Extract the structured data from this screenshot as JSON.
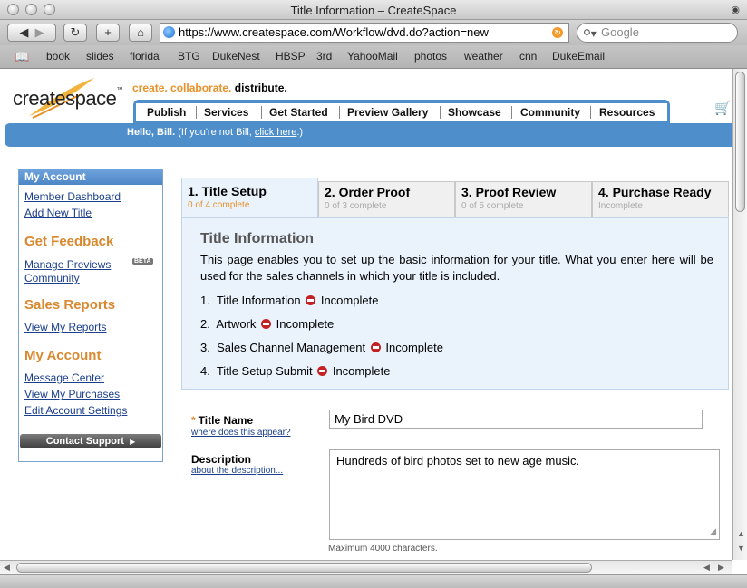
{
  "window": {
    "title": "Title Information – CreateSpace"
  },
  "toolbar": {
    "url": "https://www.createspace.com/Workflow/dvd.do?action=new",
    "search_placeholder": "Google"
  },
  "bookmarks": [
    "book",
    "slides",
    "florida",
    "BTG",
    "DukeNest",
    "HBSP",
    "3rd",
    "YahooMail",
    "photos",
    "weather",
    "cnn",
    "DukeEmail"
  ],
  "header": {
    "logo": "createspace",
    "tagline_part1": "create. collaborate.",
    "tagline_part2": "distribute.",
    "nav": [
      "Publish",
      "Services",
      "Get Started",
      "Preview Gallery",
      "Showcase",
      "Community",
      "Resources"
    ],
    "hello_name": "Hello, Bill.",
    "hello_note": "(If you're not Bill,",
    "hello_link": "click here",
    "hello_end": ".)"
  },
  "sidebar": {
    "top_header": "My Account",
    "links1": [
      "Member Dashboard",
      "Add New Title"
    ],
    "feedback_heading": "Get Feedback",
    "feedback_links": [
      "Manage Previews",
      "Community"
    ],
    "beta": "BETA",
    "reports_heading": "Sales Reports",
    "reports_links": [
      "View My Reports"
    ],
    "account_heading": "My Account",
    "account_links": [
      "Message Center",
      "View My Purchases",
      "Edit Account Settings"
    ],
    "contact_button": "Contact Support"
  },
  "steps": [
    {
      "label": "1. Title Setup",
      "status": "0 of 4 complete",
      "active": true
    },
    {
      "label": "2. Order Proof",
      "status": "0 of 3 complete",
      "active": false
    },
    {
      "label": "3. Proof Review",
      "status": "0 of 5 complete",
      "active": false
    },
    {
      "label": "4. Purchase Ready",
      "status": "Incomplete",
      "active": false
    }
  ],
  "info": {
    "title": "Title Information",
    "text": "This page enables you to set up the basic information for your title. What you enter here will be used for the sales channels in which your title is included.",
    "items": [
      {
        "num": "1.",
        "name": "Title Information",
        "status": "Incomplete"
      },
      {
        "num": "2.",
        "name": "Artwork",
        "status": "Incomplete"
      },
      {
        "num": "3.",
        "name": "Sales Channel Management",
        "status": "Incomplete"
      },
      {
        "num": "4.",
        "name": "Title Setup Submit",
        "status": "Incomplete"
      }
    ]
  },
  "form": {
    "required_mark": "*",
    "title_label": "Title Name",
    "title_help": "where does this appear?",
    "title_value": "My Bird DVD",
    "desc_label": "Description",
    "desc_help": "about the description...",
    "desc_value": "Hundreds of bird photos set to new age music.",
    "max_chars": "Maximum 4000 characters."
  },
  "colors": {
    "brand_blue": "#4d8ecb",
    "accent_orange": "#d8892f",
    "link": "#1b3f8b"
  }
}
